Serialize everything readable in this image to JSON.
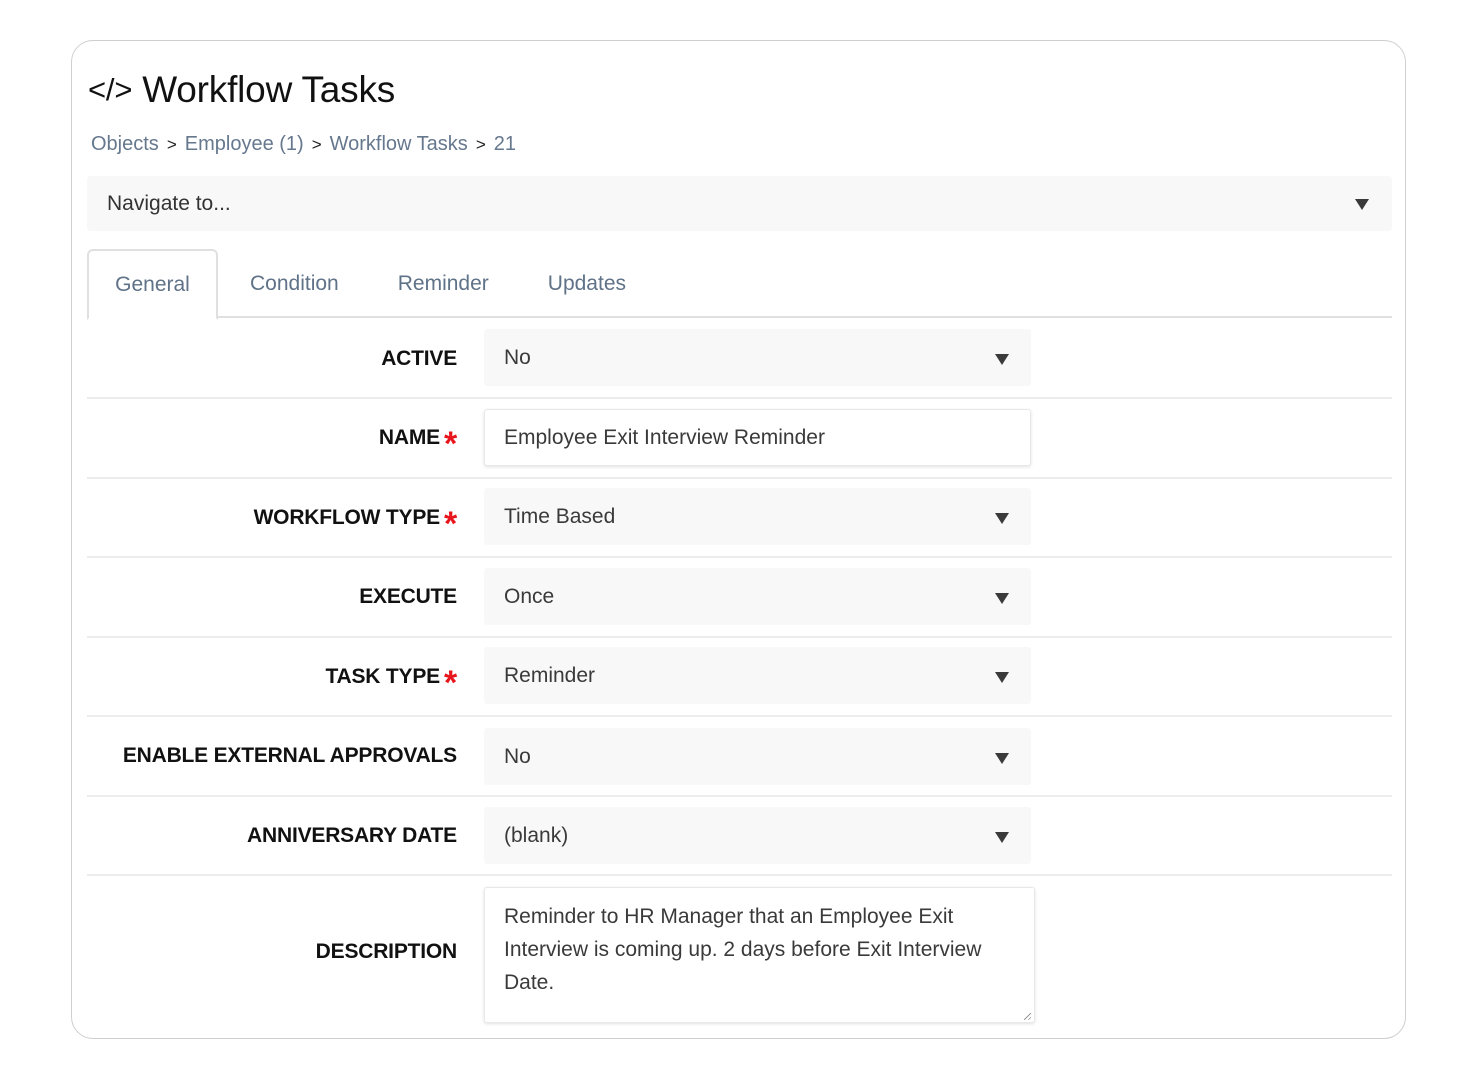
{
  "header": {
    "icon": "code-icon",
    "icon_glyph": "</>",
    "title": "Workflow Tasks"
  },
  "breadcrumb": {
    "items": [
      "Objects",
      "Employee (1)",
      "Workflow Tasks"
    ],
    "separator": ">",
    "current": "21"
  },
  "navigate": {
    "label": "Navigate to..."
  },
  "tabs": [
    {
      "label": "General",
      "active": true
    },
    {
      "label": "Condition",
      "active": false
    },
    {
      "label": "Reminder",
      "active": false
    },
    {
      "label": "Updates",
      "active": false
    }
  ],
  "form": {
    "required_marker": "*",
    "fields": [
      {
        "label": "ACTIVE",
        "type": "select",
        "value": "No",
        "required": false
      },
      {
        "label": "NAME",
        "type": "text",
        "value": "Employee Exit Interview Reminder",
        "required": true
      },
      {
        "label": "WORKFLOW TYPE",
        "type": "select",
        "value": "Time Based",
        "required": true
      },
      {
        "label": "EXECUTE",
        "type": "select",
        "value": "Once",
        "required": false
      },
      {
        "label": "TASK TYPE",
        "type": "select",
        "value": "Reminder",
        "required": true
      },
      {
        "label": "ENABLE EXTERNAL APPROVALS",
        "type": "select",
        "value": "No",
        "required": false
      },
      {
        "label": "ANNIVERSARY DATE",
        "type": "select",
        "value": "(blank)",
        "required": false
      },
      {
        "label": "DESCRIPTION",
        "type": "textarea",
        "value": "Reminder to HR Manager that an Employee Exit Interview is coming up. 2 days before Exit Interview Date.",
        "required": false
      }
    ]
  },
  "colors": {
    "required": "#e8161c",
    "breadcrumb_link": "#66788e",
    "tab_text": "#5f7287"
  }
}
